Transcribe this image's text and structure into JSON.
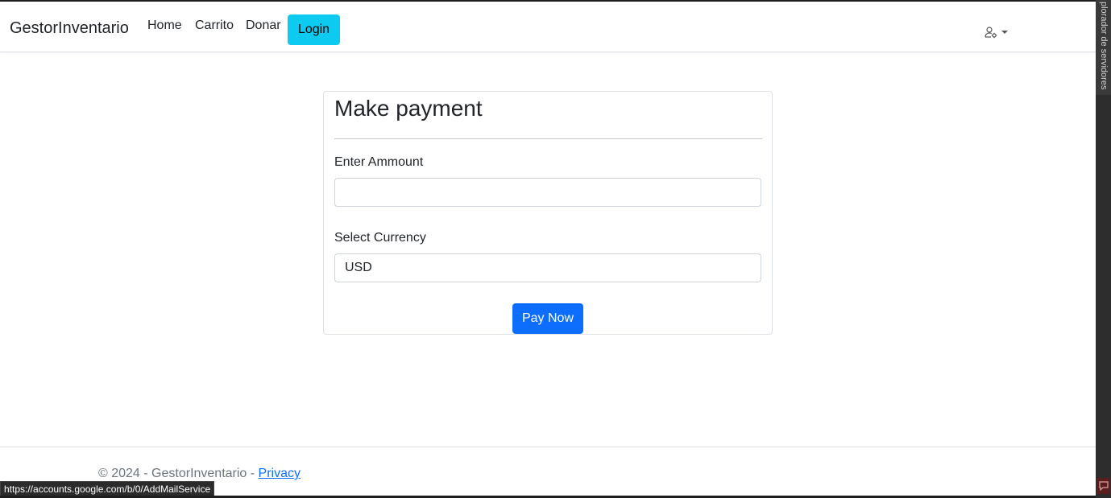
{
  "navbar": {
    "brand": "GestorInventario",
    "links": [
      "Home",
      "Carrito",
      "Donar"
    ],
    "login_label": "Login",
    "user_icon": "user-settings-icon"
  },
  "payment": {
    "title": "Make payment",
    "amount_label": "Enter Ammount",
    "amount_value": "",
    "currency_label": "Select Currency",
    "currency_value": "USD",
    "pay_label": "Pay Now"
  },
  "footer": {
    "copyright": "© 2024 - GestorInventario - ",
    "privacy_label": "Privacy"
  },
  "status_bar": {
    "url": "https://accounts.google.com/b/0/AddMailService"
  },
  "side_panel": {
    "label": "plorador de servidores",
    "icon": "comment-icon"
  },
  "colors": {
    "login_button": "#0dcaf0",
    "pay_button": "#0d6efd",
    "link": "#0d6efd"
  }
}
